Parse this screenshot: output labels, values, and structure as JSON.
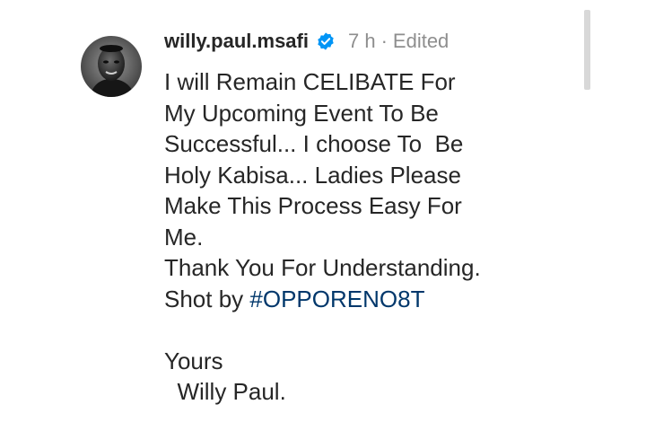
{
  "post": {
    "username": "willy.paul.msafi",
    "time": "7 h",
    "separator": "·",
    "edited": "Edited",
    "avatar_icon": "profile-avatar",
    "verified_icon": "verified-badge-icon",
    "colors": {
      "verified": "#0095f6",
      "hashtag": "#00376b",
      "meta": "#8e8e8e",
      "text": "#262626"
    }
  },
  "caption": {
    "line1": "I will Remain CELIBATE For",
    "line2": "My Upcoming Event To Be",
    "line3": "Successful... I choose To  Be",
    "line4": "Holy Kabisa... Ladies Please",
    "line5": "Make This Process Easy For",
    "line6": "Me.",
    "line7": "Thank You For Understanding.",
    "line8_prefix": "Shot by ",
    "hashtag": "#OPPORENO8T",
    "line10": "Yours",
    "line11": "  Willy Paul."
  }
}
